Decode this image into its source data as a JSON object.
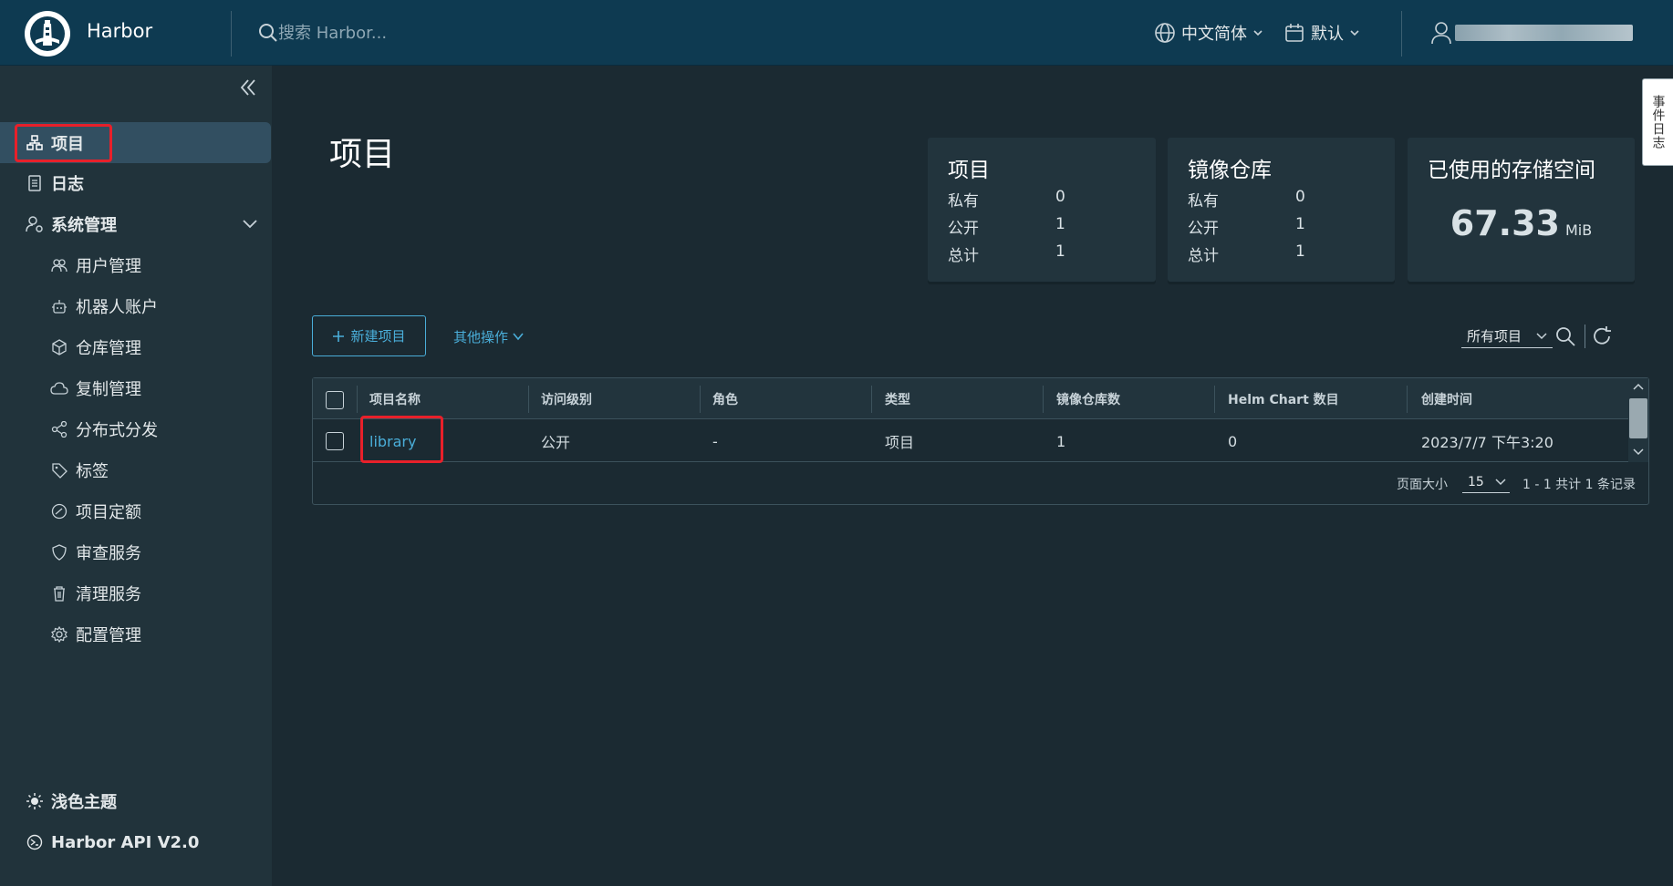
{
  "header": {
    "brand": "Harbor",
    "search_placeholder": "搜索 Harbor...",
    "language": "中文简体",
    "calendar": "默认"
  },
  "sidebar": {
    "items": [
      {
        "label": "项目",
        "icon": "project-icon",
        "active": true
      },
      {
        "label": "日志",
        "icon": "log-icon"
      },
      {
        "label": "系统管理",
        "icon": "admin-icon"
      }
    ],
    "admin_sub": [
      {
        "label": "用户管理",
        "icon": "users-icon"
      },
      {
        "label": "机器人账户",
        "icon": "robot-icon"
      },
      {
        "label": "仓库管理",
        "icon": "registry-icon"
      },
      {
        "label": "复制管理",
        "icon": "replication-icon"
      },
      {
        "label": "分布式分发",
        "icon": "share-icon"
      },
      {
        "label": "标签",
        "icon": "tag-icon"
      },
      {
        "label": "项目定额",
        "icon": "quota-icon"
      },
      {
        "label": "审查服务",
        "icon": "shield-icon"
      },
      {
        "label": "清理服务",
        "icon": "trash-icon"
      },
      {
        "label": "配置管理",
        "icon": "gear-icon"
      }
    ],
    "bottom": {
      "theme": "浅色主题",
      "api": "Harbor API V2.0"
    }
  },
  "page": {
    "title": "项目"
  },
  "cards": {
    "projects": {
      "title": "项目",
      "rows": [
        {
          "label": "私有",
          "value": "0"
        },
        {
          "label": "公开",
          "value": "1"
        },
        {
          "label": "总计",
          "value": "1"
        }
      ]
    },
    "repos": {
      "title": "镜像仓库",
      "rows": [
        {
          "label": "私有",
          "value": "0"
        },
        {
          "label": "公开",
          "value": "1"
        },
        {
          "label": "总计",
          "value": "1"
        }
      ]
    },
    "storage": {
      "title": "已使用的存储空间",
      "value": "67.33",
      "unit": "MiB"
    }
  },
  "toolbar": {
    "new_project": "新建项目",
    "other_actions": "其他操作",
    "filter": "所有项目"
  },
  "table": {
    "columns": [
      "项目名称",
      "访问级别",
      "角色",
      "类型",
      "镜像仓库数",
      "Helm Chart 数目",
      "创建时间"
    ],
    "rows": [
      {
        "name": "library",
        "access": "公开",
        "role": "-",
        "type": "项目",
        "repos": "1",
        "helm": "0",
        "created": "2023/7/7 下午3:20"
      }
    ],
    "footer": {
      "page_size_label": "页面大小",
      "page_size": "15",
      "info": "1 - 1 共计 1 条记录"
    }
  },
  "side_tab": "事件日志",
  "colors": {
    "header_bg": "#0e3a51",
    "sidebar_bg": "#21333b",
    "main_bg": "#1b2a32",
    "accent": "#4aaed9",
    "highlight": "#e8202a"
  }
}
